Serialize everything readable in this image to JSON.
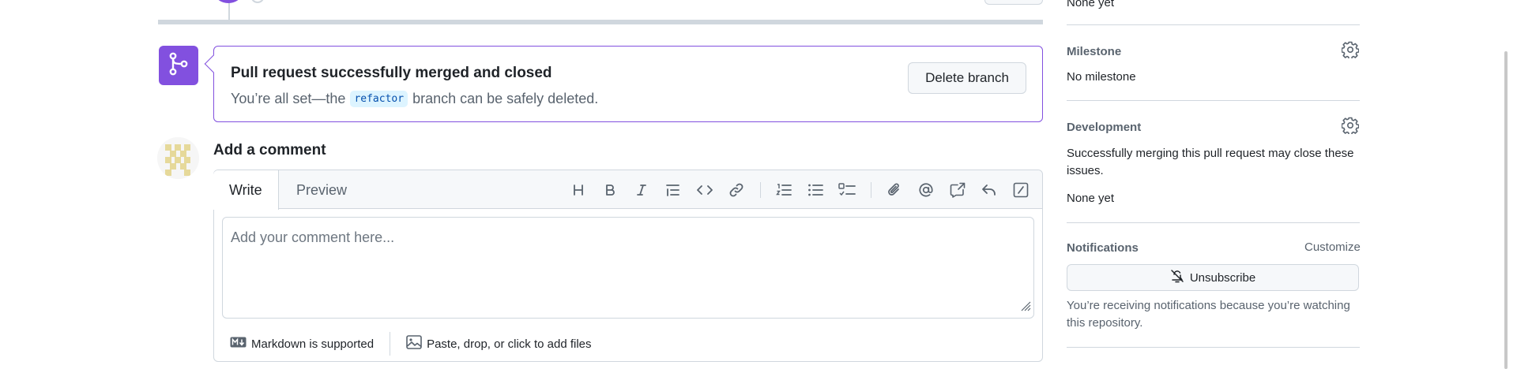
{
  "merge_status": {
    "title": "Pull request successfully merged and closed",
    "subtitle_prefix": "You’re all set—the",
    "branch": "refactor",
    "subtitle_suffix": "branch can be safely deleted.",
    "delete_button": "Delete branch",
    "accent_color": "#8250df"
  },
  "comment": {
    "heading": "Add a comment",
    "tabs": {
      "write": "Write",
      "preview": "Preview"
    },
    "toolbar_icons": [
      "heading-icon",
      "bold-icon",
      "italic-icon",
      "quote-icon",
      "code-icon",
      "link-icon",
      "ordered-list-icon",
      "unordered-list-icon",
      "task-list-icon",
      "attach-icon",
      "mention-icon",
      "cross-reference-icon",
      "reply-icon",
      "slash-commands-icon"
    ],
    "placeholder": "Add your comment here...",
    "markdown_note": "Markdown is supported",
    "files_note": "Paste, drop, or click to add files"
  },
  "sidebar": {
    "top_value": "None yet",
    "milestone": {
      "label": "Milestone",
      "value": "No milestone"
    },
    "development": {
      "label": "Development",
      "description": "Successfully merging this pull request may close these issues.",
      "value": "None yet"
    },
    "notifications": {
      "label": "Notifications",
      "customize": "Customize",
      "unsubscribe": "Unsubscribe",
      "note": "You’re receiving notifications because you’re watching this repository."
    }
  }
}
